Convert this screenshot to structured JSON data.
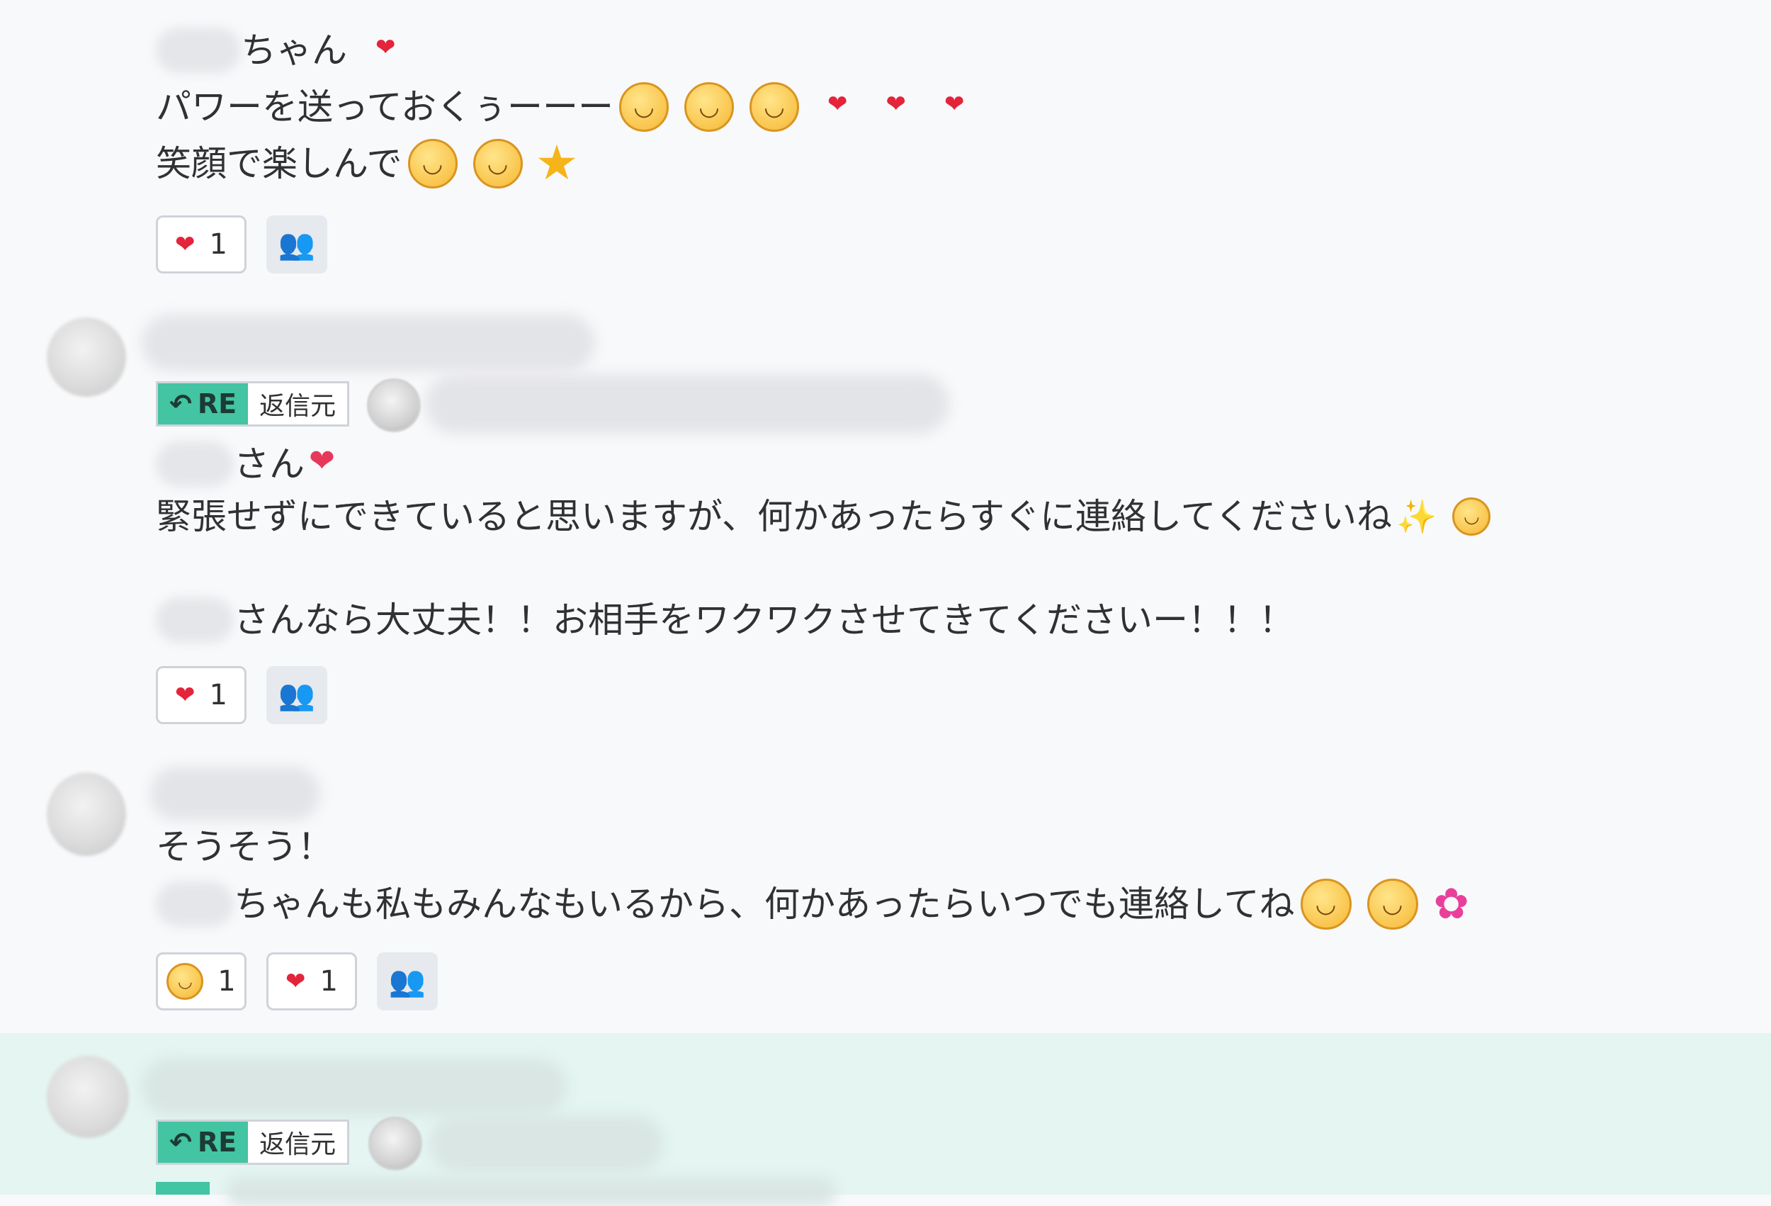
{
  "messages": [
    {
      "mention_suffix": "ちゃん",
      "line1": "パワーを送っておくぅーーー",
      "line2": "笑顔で楽しんで",
      "reaction_count": "1",
      "list_icon": "user-list-icon"
    },
    {
      "re_label": "RE",
      "re_source_label": "返信元",
      "mention_suffix": "さん",
      "line1": "緊張せずにできていると思いますが、何かあったらすぐに連絡してくださいね",
      "line2_suffix": "さんなら大丈夫！！お相手をワクワクさせてきてくださいー！！！",
      "reaction_count": "1"
    },
    {
      "line1": "そうそう！",
      "line2_suffix": "ちゃんも私もみんなもいるから、何かあったらいつでも連絡してね",
      "reaction_emoji_count": "1",
      "reaction_heart_count": "1"
    },
    {
      "re_label": "RE",
      "re_source_label": "返信元"
    }
  ],
  "colors": {
    "heart": "#e3243b",
    "re_badge": "#43c4a3",
    "highlight_bg": "#e4f5f2",
    "page_bg": "#f8f9fb"
  },
  "icons": [
    "heart-icon",
    "grinning-sweat-face-icon",
    "star-icon",
    "sparkle-icon",
    "smiling-face-icon",
    "flower-icon",
    "reply-arrow-icon",
    "user-list-icon"
  ]
}
